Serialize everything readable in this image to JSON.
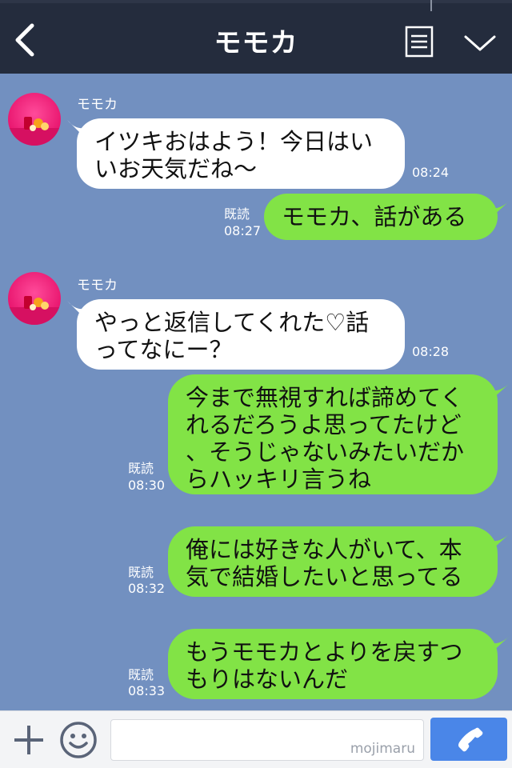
{
  "header": {
    "title": "モモカ",
    "back_icon": "back-chevron-icon",
    "menu_icon": "document-menu-icon",
    "collapse_icon": "chevron-down-icon"
  },
  "messages": [
    {
      "direction": "in",
      "sender": "モモカ",
      "lines": [
        "イツキおはよう！今日はい",
        "いお天気だね〜"
      ],
      "time": "08:24"
    },
    {
      "direction": "out",
      "read": "既読",
      "lines": [
        "モモカ、話がある"
      ],
      "time": "08:27"
    },
    {
      "direction": "in",
      "sender": "モモカ",
      "lines": [
        "やっと返信してくれた♡話",
        "ってなにー？"
      ],
      "time": "08:28"
    },
    {
      "direction": "out",
      "read": "既読",
      "lines": [
        "今まで無視すれば諦めてく",
        "れるだろうよ思ってたけど",
        "、そうじゃないみたいだか",
        "らハッキリ言うね"
      ],
      "time": "08:30"
    },
    {
      "direction": "out",
      "read": "既読",
      "lines": [
        "俺には好きな人がいて、本",
        "気で結婚したいと思ってる"
      ],
      "time": "08:32"
    },
    {
      "direction": "out",
      "read": "既読",
      "lines": [
        "もうモモカとよりを戻すつ",
        "もりはないんだ"
      ],
      "time": "08:33"
    }
  ],
  "input_bar": {
    "plus_icon": "plus-icon",
    "emoji_icon": "smiley-icon",
    "placeholder": "",
    "watermark": "mojimaru",
    "call_icon": "phone-icon"
  },
  "colors": {
    "header_bg": "#242c3d",
    "chat_bg": "#7290c0",
    "incoming_bubble": "#ffffff",
    "outgoing_bubble": "#82e346",
    "call_button": "#4a86e8"
  }
}
